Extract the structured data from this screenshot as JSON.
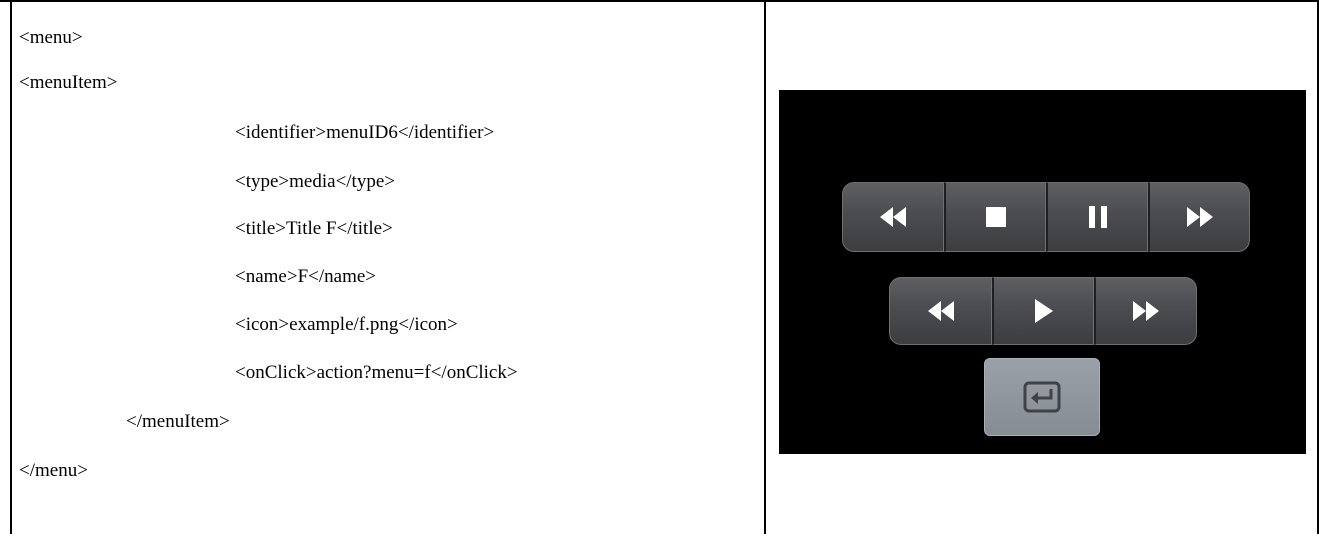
{
  "code_lines": [
    "<menu>",
    "<menuItem>",
    "<identifier>menuID6</identifier>",
    "<type>media</type>",
    "<title>Title F</title>",
    "<name>F</name>",
    "<icon>example/f.png</icon>",
    "<onClick>action?menu=f</onClick>",
    "</menuItem>",
    "</menu>"
  ],
  "media_panel": {
    "row1": [
      "rewind-icon",
      "stop-icon",
      "pause-icon",
      "fast-forward-icon"
    ],
    "row2": [
      "rewind-icon",
      "play-icon",
      "fast-forward-icon"
    ],
    "row3": [
      "input-source-icon"
    ],
    "colors": {
      "panel_background": "#000000",
      "button_dark": "#4a4c4f",
      "button_light": "#8f969d",
      "icon": "#ffffff"
    }
  }
}
